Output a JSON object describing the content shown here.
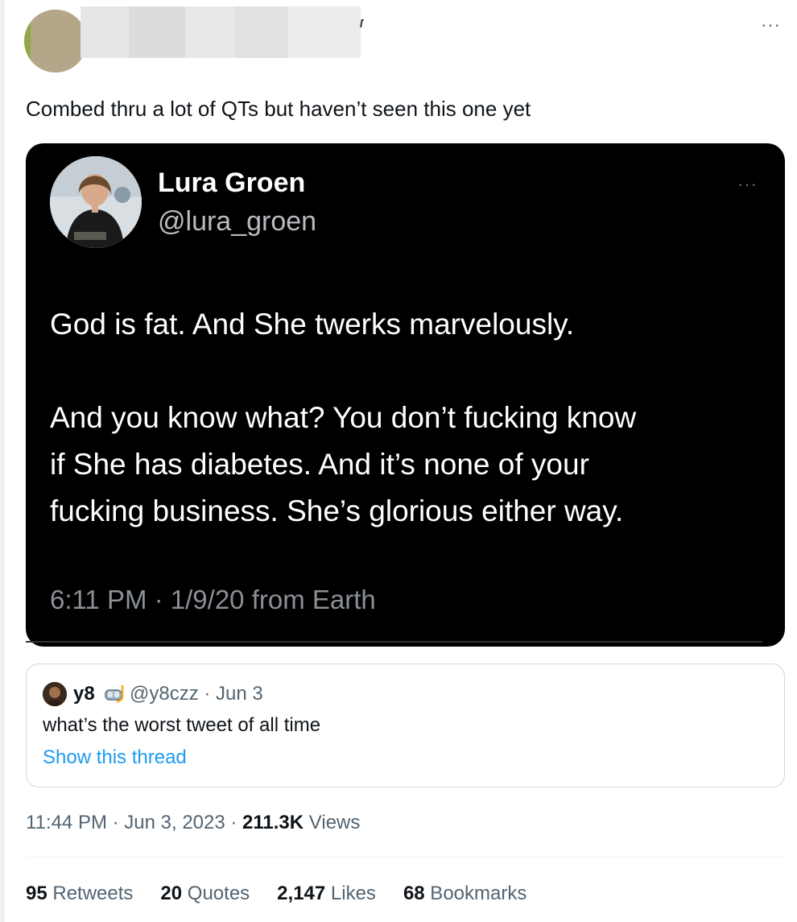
{
  "header": {
    "more_label": "···"
  },
  "tweet": {
    "text": "Combed thru a lot of QTs but haven’t seen this one yet",
    "timestamp": "11:44 PM · Jun 3, 2023 · ",
    "views_count": "211.3K",
    "views_label": " Views"
  },
  "embedded_screenshot": {
    "name": "Lura Groen",
    "handle": "@lura_groen",
    "more_label": "···",
    "paragraph1": "God is fat.  And She twerks marvelously.",
    "paragraph2_line1": "And you know what? You don’t fucking know",
    "paragraph2_line2": "if She has diabetes. And it’s none of your",
    "paragraph2_line3": "fucking business. She’s glorious either way.",
    "meta": "6:11 PM · 1/9/20 from Earth"
  },
  "quoted_tweet": {
    "name": "y8",
    "handle_date": "@y8czz · Jun 3",
    "text": "what’s the worst tweet of all time",
    "link": "Show this thread"
  },
  "stats": [
    {
      "count": "95",
      "label": " Retweets"
    },
    {
      "count": "20",
      "label": " Quotes"
    },
    {
      "count": "2,147",
      "label": " Likes"
    },
    {
      "count": "68",
      "label": " Bookmarks"
    }
  ]
}
